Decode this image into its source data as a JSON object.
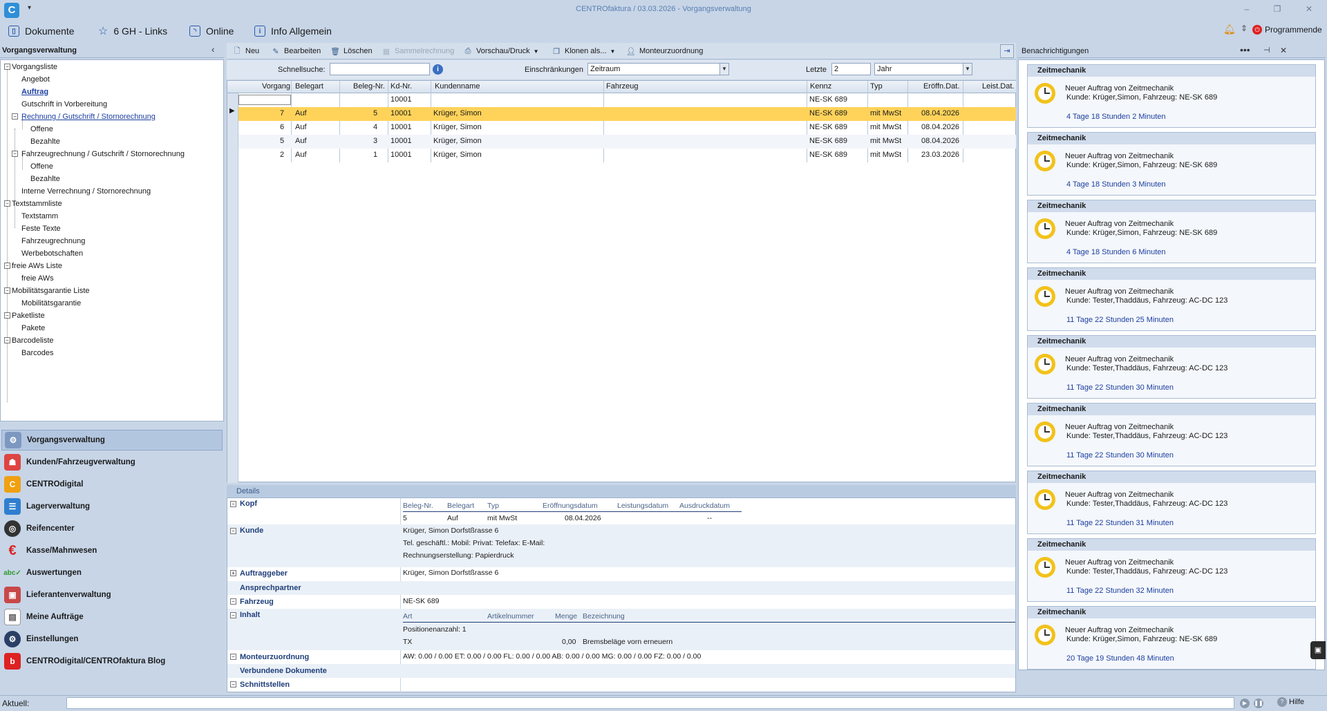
{
  "window": {
    "title": "CENTROfaktura / 03.03.2026 - Vorgangsverwaltung",
    "app_icon": "centro-logo-icon",
    "qat_symbol": "▾"
  },
  "menu": {
    "items": [
      {
        "label": "Dokumente",
        "icon": "book-icon"
      },
      {
        "label": "6 GH - Links",
        "icon": "star-icon"
      },
      {
        "label": "Online",
        "icon": "rss-icon"
      },
      {
        "label": "Info Allgemein",
        "icon": "info-icon"
      }
    ],
    "programmende": "Programmende"
  },
  "left": {
    "title": "Vorgangsverwaltung",
    "tree": [
      {
        "label": "Vorgangsliste"
      },
      {
        "label": "Angebot"
      },
      {
        "label": "Auftrag"
      },
      {
        "label": "Gutschrift in Vorbereitung"
      },
      {
        "label": "Rechnung / Gutschrift / Stornorechnung"
      },
      {
        "label": "Offene"
      },
      {
        "label": "Bezahlte"
      },
      {
        "label": "Fahrzeugrechnung / Gutschrift / Stornorechnung"
      },
      {
        "label": "Offene"
      },
      {
        "label": "Bezahlte"
      },
      {
        "label": "Interne Verrechnung / Stornorechnung"
      },
      {
        "label": "Textstammliste"
      },
      {
        "label": "Textstamm"
      },
      {
        "label": "Feste Texte"
      },
      {
        "label": "Fahrzeugrechnung"
      },
      {
        "label": "Werbebotschaften"
      },
      {
        "label": "freie AWs Liste"
      },
      {
        "label": "freie AWs"
      },
      {
        "label": "Mobilitätsgarantie Liste"
      },
      {
        "label": "Mobilitätsgarantie"
      },
      {
        "label": "Paketliste"
      },
      {
        "label": "Pakete"
      },
      {
        "label": "Barcodeliste"
      },
      {
        "label": "Barcodes"
      }
    ],
    "nav": [
      {
        "label": "Vorgangsverwaltung",
        "icon": "vorgang-icon"
      },
      {
        "label": "Kunden/Fahrzeugverwaltung",
        "icon": "customers-icon"
      },
      {
        "label": "CENTROdigital",
        "icon": "centrodigital-icon"
      },
      {
        "label": "Lagerverwaltung",
        "icon": "warehouse-icon"
      },
      {
        "label": "Reifencenter",
        "icon": "tire-icon"
      },
      {
        "label": "Kasse/Mahnwesen",
        "icon": "euro-icon"
      },
      {
        "label": "Auswertungen",
        "icon": "abc-check-icon"
      },
      {
        "label": "Lieferantenverwaltung",
        "icon": "supplier-icon"
      },
      {
        "label": "Meine Aufträge",
        "icon": "document-icon"
      },
      {
        "label": "Einstellungen",
        "icon": "settings-icon"
      },
      {
        "label": "CENTROdigital/CENTROfaktura Blog",
        "icon": "blog-icon"
      }
    ]
  },
  "toolbar": {
    "neu": "Neu",
    "bearbeiten": "Bearbeiten",
    "loeschen": "Löschen",
    "sammelrechnung": "Sammelrechnung",
    "vorschau": "Vorschau/Druck",
    "klonen": "Klonen als...",
    "monteur": "Monteurzuordnung"
  },
  "filter": {
    "schnellsuche_label": "Schnellsuche:",
    "schnellsuche_value": "",
    "einschraenkungen_label": "Einschränkungen",
    "einschraenkungen_value": "Zeitraum",
    "letzte_label": "Letzte",
    "letzte_value": "2",
    "unit_value": "Jahr"
  },
  "grid": {
    "columns": [
      "Vorgang",
      "Belegart",
      "Beleg-Nr.",
      "Kd-Nr.",
      "Kundenname",
      "Fahrzeug",
      "Kennz",
      "Typ",
      "Eröffn.Dat.",
      "Leist.Dat."
    ],
    "filter_row": {
      "kdnr": "10001",
      "kennz": "NE-SK 689"
    },
    "rows": [
      {
        "vorgang": "7",
        "belegart": "Auf",
        "belegnr": "5",
        "kdnr": "10001",
        "kunde": "Krüger, Simon",
        "fahrzeug": "",
        "kennz": "NE-SK 689",
        "typ": "mit MwSt",
        "eroeffn": "08.04.2026",
        "leist": ""
      },
      {
        "vorgang": "6",
        "belegart": "Auf",
        "belegnr": "4",
        "kdnr": "10001",
        "kunde": "Krüger, Simon",
        "fahrzeug": "",
        "kennz": "NE-SK 689",
        "typ": "mit MwSt",
        "eroeffn": "08.04.2026",
        "leist": ""
      },
      {
        "vorgang": "5",
        "belegart": "Auf",
        "belegnr": "3",
        "kdnr": "10001",
        "kunde": "Krüger, Simon",
        "fahrzeug": "",
        "kennz": "NE-SK 689",
        "typ": "mit MwSt",
        "eroeffn": "08.04.2026",
        "leist": ""
      },
      {
        "vorgang": "2",
        "belegart": "Auf",
        "belegnr": "1",
        "kdnr": "10001",
        "kunde": "Krüger, Simon",
        "fahrzeug": "",
        "kennz": "NE-SK 689",
        "typ": "mit MwSt",
        "eroeffn": "23.03.2026",
        "leist": ""
      }
    ]
  },
  "details": {
    "header": "Details",
    "kopf": {
      "label": "Kopf",
      "cols": [
        "Beleg-Nr.",
        "Belegart",
        "Typ",
        "Eröffnungsdatum",
        "Leistungsdatum",
        "Ausdruckdatum"
      ],
      "values": [
        "5",
        "Auf",
        "mit MwSt",
        "08.04.2026",
        "",
        "--"
      ]
    },
    "kunde": {
      "label": "Kunde",
      "line1": "Krüger, Simon Dorfstßrasse 6",
      "line2": "Tel. geschäftl.:     Mobil:      Privat:      Telefax:      E-Mail:",
      "line3": "Rechnungserstellung: Papierdruck"
    },
    "auftraggeber": {
      "label": "Auftraggeber",
      "value": "Krüger, Simon Dorfstßrasse 6"
    },
    "ansprechpartner": {
      "label": "Ansprechpartner"
    },
    "fahrzeug": {
      "label": "Fahrzeug",
      "value": "NE-SK 689"
    },
    "inhalt": {
      "label": "Inhalt",
      "cols": [
        "Art",
        "Artikelnummer",
        "Menge",
        "Bezeichnung"
      ],
      "positionen": "Positionenanzahl: 1",
      "row": {
        "art": "TX",
        "menge": "0,00",
        "bezeichnung": "Bremsbeläge vorn erneuern"
      }
    },
    "monteur": {
      "label": "Monteurzuordnung",
      "value": "AW: 0.00 / 0.00   ET: 0.00 / 0.00   FL: 0.00 / 0.00   AB: 0.00 / 0.00   MG: 0.00 / 0.00   FZ: 0.00 / 0.00"
    },
    "dokumente": {
      "label": "Verbundene Dokumente"
    },
    "schnittstellen": {
      "label": "Schnittstellen"
    }
  },
  "notifications": {
    "title": "Benachrichtigungen",
    "cards": [
      {
        "title": "Zeitmechanik",
        "line1": "Neuer Auftrag von Zeitmechanik",
        "line2": "Kunde: Krüger,Simon, Fahrzeug: NE-SK 689",
        "time": "4 Tage 18 Stunden 2 Minuten"
      },
      {
        "title": "Zeitmechanik",
        "line1": "Neuer Auftrag von Zeitmechanik",
        "line2": "Kunde: Krüger,Simon, Fahrzeug: NE-SK 689",
        "time": "4 Tage 18 Stunden 3 Minuten"
      },
      {
        "title": "Zeitmechanik",
        "line1": "Neuer Auftrag von Zeitmechanik",
        "line2": "Kunde: Krüger,Simon, Fahrzeug: NE-SK 689",
        "time": "4 Tage 18 Stunden 6 Minuten"
      },
      {
        "title": "Zeitmechanik",
        "line1": "Neuer Auftrag von Zeitmechanik",
        "line2": "Kunde: Tester,Thaddäus, Fahrzeug: AC-DC 123",
        "time": "11 Tage 22 Stunden 25 Minuten"
      },
      {
        "title": "Zeitmechanik",
        "line1": "Neuer Auftrag von Zeitmechanik",
        "line2": "Kunde: Tester,Thaddäus, Fahrzeug: AC-DC 123",
        "time": "11 Tage 22 Stunden 30 Minuten"
      },
      {
        "title": "Zeitmechanik",
        "line1": "Neuer Auftrag von Zeitmechanik",
        "line2": "Kunde: Tester,Thaddäus, Fahrzeug: AC-DC 123",
        "time": "11 Tage 22 Stunden 30 Minuten"
      },
      {
        "title": "Zeitmechanik",
        "line1": "Neuer Auftrag von Zeitmechanik",
        "line2": "Kunde: Tester,Thaddäus, Fahrzeug: AC-DC 123",
        "time": "11 Tage 22 Stunden 31 Minuten"
      },
      {
        "title": "Zeitmechanik",
        "line1": "Neuer Auftrag von Zeitmechanik",
        "line2": "Kunde: Tester,Thaddäus, Fahrzeug: AC-DC 123",
        "time": "11 Tage 22 Stunden 32 Minuten"
      },
      {
        "title": "Zeitmechanik",
        "line1": "Neuer Auftrag von Zeitmechanik",
        "line2": "Kunde: Krüger,Simon, Fahrzeug: NE-SK 689",
        "time": "20 Tage 19 Stunden 48 Minuten"
      }
    ]
  },
  "status": {
    "label": "Aktuell:",
    "value": "",
    "hilfe": "Hilfe"
  },
  "colors": {
    "selected_row": "#ffd35a",
    "accent": "#1d3fa0",
    "panel_bg": "#c7d5e7"
  }
}
